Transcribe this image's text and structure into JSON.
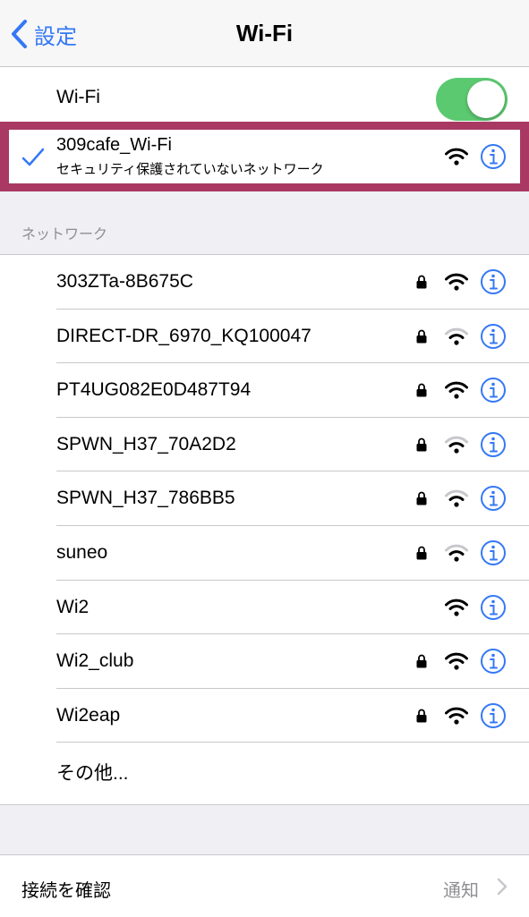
{
  "nav": {
    "back_label": "設定",
    "title": "Wi-Fi"
  },
  "wifi_toggle": {
    "label": "Wi-Fi",
    "on": true
  },
  "connected": {
    "name": "309cafe_Wi-Fi",
    "subtitle": "セキュリティ保護されていないネットワーク",
    "highlight_color": "#a93963"
  },
  "networks_header": "ネットワーク",
  "networks": [
    {
      "name": "303ZTa-8B675C",
      "lock": true,
      "signal": "strong"
    },
    {
      "name": "DIRECT-DR_6970_KQ100047",
      "lock": true,
      "signal": "weak"
    },
    {
      "name": "PT4UG082E0D487T94",
      "lock": true,
      "signal": "strong"
    },
    {
      "name": "SPWN_H37_70A2D2",
      "lock": true,
      "signal": "weak"
    },
    {
      "name": "SPWN_H37_786BB5",
      "lock": true,
      "signal": "weak"
    },
    {
      "name": "suneo",
      "lock": true,
      "signal": "weak"
    },
    {
      "name": "Wi2",
      "lock": false,
      "signal": "strong"
    },
    {
      "name": "Wi2_club",
      "lock": true,
      "signal": "strong"
    },
    {
      "name": "Wi2eap",
      "lock": true,
      "signal": "strong"
    }
  ],
  "other_label": "その他...",
  "confirm": {
    "label": "接続を確認",
    "value": "通知"
  },
  "colors": {
    "accent": "#3478f6",
    "toggle_on": "#5bc970"
  }
}
